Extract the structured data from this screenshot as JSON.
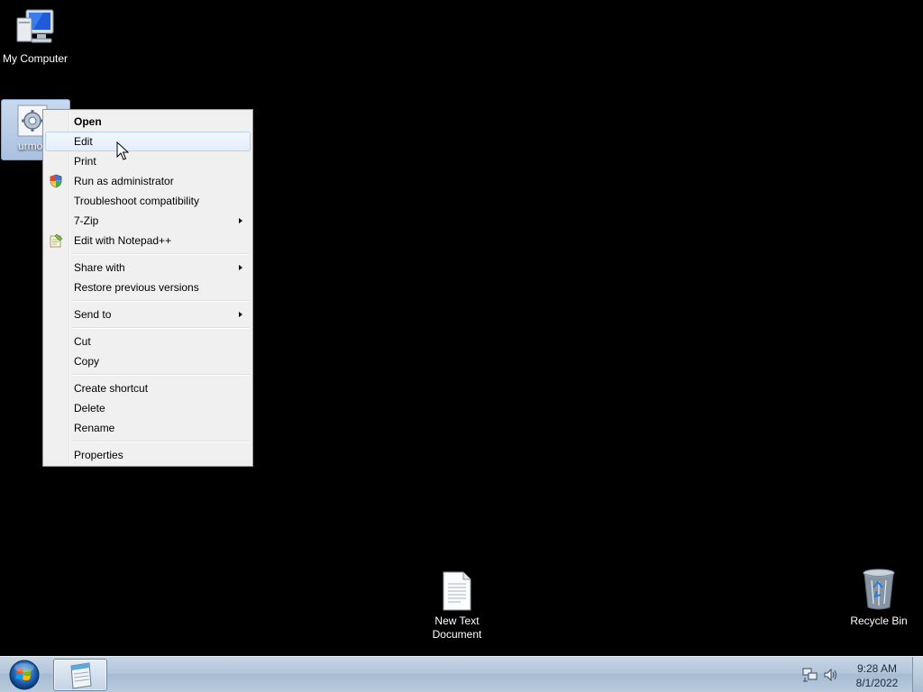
{
  "desktop": {
    "icons": [
      {
        "label": "My Computer",
        "icon": "computer-icon"
      },
      {
        "label": "urmo",
        "icon": "gear-settings-file-icon",
        "selected": true
      },
      {
        "label": "New Text Document",
        "label_line1": "New Text",
        "label_line2": "Document",
        "icon": "text-document-icon"
      },
      {
        "label": "Recycle Bin",
        "icon": "recycle-bin-icon"
      }
    ]
  },
  "context_menu": {
    "groups": [
      {
        "items": [
          {
            "label": "Open",
            "bold": true
          },
          {
            "label": "Edit",
            "highlighted": true
          },
          {
            "label": "Print"
          },
          {
            "label": "Run as administrator",
            "icon": "uac-shield-icon"
          },
          {
            "label": "Troubleshoot compatibility"
          },
          {
            "label": "7-Zip",
            "submenu": true
          },
          {
            "label": "Edit with Notepad++",
            "icon": "notepad-plus-plus-icon"
          }
        ]
      },
      {
        "items": [
          {
            "label": "Share with",
            "submenu": true
          },
          {
            "label": "Restore previous versions"
          }
        ]
      },
      {
        "items": [
          {
            "label": "Send to",
            "submenu": true
          }
        ]
      },
      {
        "items": [
          {
            "label": "Cut"
          },
          {
            "label": "Copy"
          }
        ]
      },
      {
        "items": [
          {
            "label": "Create shortcut"
          },
          {
            "label": "Delete"
          },
          {
            "label": "Rename"
          }
        ]
      },
      {
        "items": [
          {
            "label": "Properties"
          }
        ]
      }
    ]
  },
  "taskbar": {
    "start_icon": "windows-start-orb-icon",
    "pinned_app_icon": "notepad-document-icon",
    "tray_icons": [
      "network-icon",
      "speaker-volume-icon"
    ],
    "clock": {
      "time": "9:28 AM",
      "date": "8/1/2022"
    }
  },
  "colors": {
    "desktop_background": "#000000",
    "menu_background": "#f0f0f0",
    "menu_highlight_border": "#b7d2f2",
    "taskbar": "#b3c6da"
  }
}
